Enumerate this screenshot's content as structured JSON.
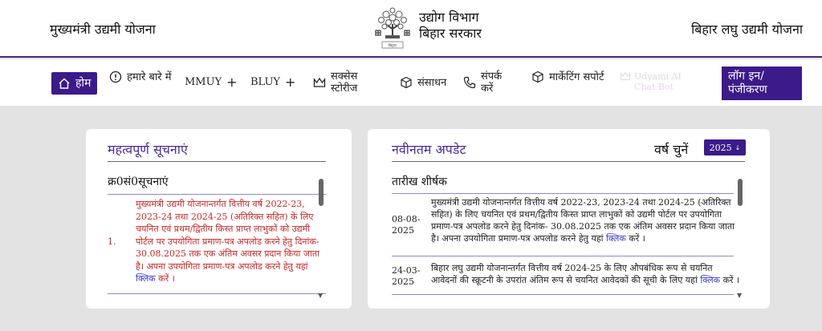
{
  "header": {
    "left_title": "मुख्यमंत्री उद्यमी योजना",
    "dept_line1": "उद्योग विभाग",
    "dept_line2": "बिहार सरकार",
    "right_title": "बिहार लघु उद्यमी योजना"
  },
  "nav": {
    "home": "होम",
    "about": "हमारे बारे में",
    "mmuy": "MMUY",
    "bluy": "BLUY",
    "success": "सक्सेस स्टोरीज",
    "resources": "संसाधन",
    "contact": "संपर्क करें",
    "marketing": "मार्केटिंग सपोर्ट",
    "chatbot": "Udyami AI Chat Bot",
    "login": "लॉग इन/ पंजीकरण"
  },
  "notices": {
    "title": "महत्वपूर्ण सूचनाएं",
    "col_header": "क्र0सं0सूचनाएं",
    "items": [
      {
        "num": "1.",
        "text": "मुख्यमंत्री उद्यमी योजनान्तर्गत वित्तीय वर्ष 2022-23, 2023-24 तथा 2024-25 (अतिरिक्त सहित) के लिए चयनित एवं प्रथम/द्वितीय किस्त प्राप्त लाभुकों को उद्यमी पोर्टल पर उपयोगिता प्रमाण-पत्र अपलोड करने हेतु दिनांक- 30.08.2025 तक एक अंतिम अवसर प्रदान किया जाता है। अपना उपयोगिता प्रमाण-पत्र अपलोड करने हेतु यहां",
        "link": "क्लिक",
        "suffix": " करें ।"
      }
    ]
  },
  "updates": {
    "title": "नवीनतम अपडेट",
    "year_label": "वर्ष चुनें",
    "year_value": "2025",
    "col_header": "तारीख शीर्षक",
    "items": [
      {
        "date": "08-08-2025",
        "text": "मुख्यमंत्री उद्यमी योजनान्तर्गत वित्तीय वर्ष 2022-23, 2023-24 तथा 2024-25 (अतिरिक्त सहित) के लिए चयनित एवं प्रथम/द्वितीय किस्त प्राप्त लाभुकों को उद्यमी पोर्टल पर उपयोगिता प्रमाण-पत्र अपलोड करने हेतु दिनांक- 30.08.2025 तक एक अंतिम अवसर प्रदान किया जाता है। अपना उपयोगिता प्रमाण-पत्र अपलोड करने हेतु यहां",
        "link": "क्लिक",
        "suffix": " करें ।"
      },
      {
        "date": "24-03-2025",
        "text": "बिहार लघु उद्यमी योजनान्तर्गत वित्तीय वर्ष 2024-25 के लिए औपबंधिक रूप से चयनित आवेदनों की स्क्रूटनी के उपरांत अंतिम रूप से चयनित आवेदकों की सूची के लिए यहां",
        "link": "क्लिक",
        "suffix": " करें ।"
      }
    ]
  },
  "colors": {
    "brand_purple": "#3b1a8a",
    "notice_red": "#c62828",
    "link_blue": "#3a3acb"
  }
}
